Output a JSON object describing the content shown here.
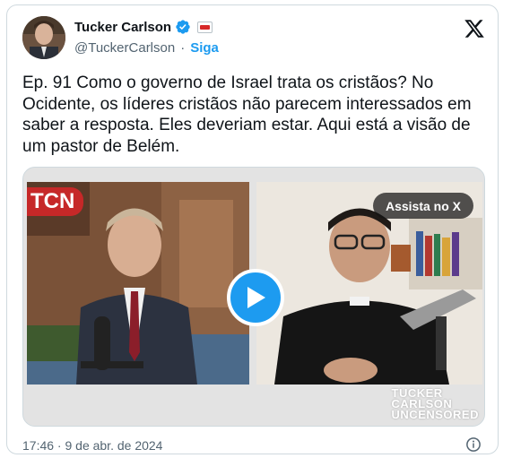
{
  "user": {
    "name": "Tucker Carlson",
    "handle": "@TuckerCarlson",
    "separator": "·",
    "follow_label": "Siga"
  },
  "tweet": {
    "text": "Ep. 91 Como o governo de Israel trata os cristãos? No Ocidente, os líderes cristãos não parecem interessados em saber a resposta. Eles deveriam estar. Aqui está a visão de um pastor de Belém."
  },
  "media": {
    "watch_label": "Assista no X",
    "left_logo_text": "TCN",
    "brand_line1": "TUCKER",
    "brand_line2": "CARLSON",
    "brand_line3": "UNCENSORED"
  },
  "footer": {
    "timestamp": "17:46 · 9 de abr. de 2024"
  },
  "colors": {
    "accent": "#1d9bf0",
    "text": "#0f1419",
    "secondary": "#536471"
  },
  "icons": [
    "verified-badge-icon",
    "affiliate-flag-icon",
    "x-logo-icon",
    "play-icon",
    "info-icon"
  ]
}
